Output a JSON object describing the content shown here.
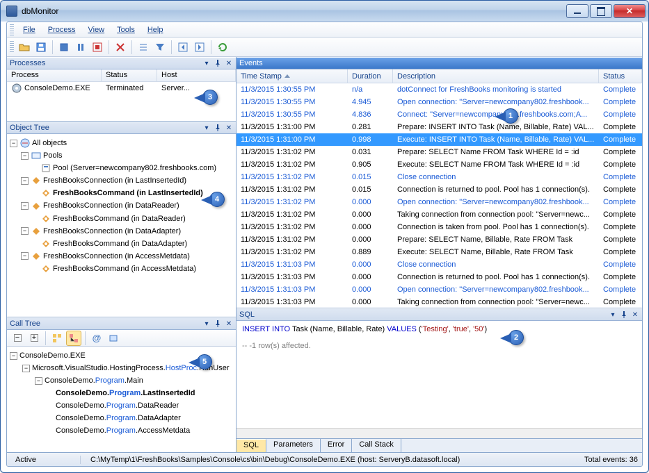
{
  "window": {
    "title": "dbMonitor"
  },
  "menu": [
    "File",
    "Process",
    "View",
    "Tools",
    "Help"
  ],
  "panels": {
    "processes": "Processes",
    "object_tree": "Object Tree",
    "call_tree": "Call Tree",
    "events": "Events",
    "sql": "SQL"
  },
  "proc_cols": {
    "p": "Process",
    "s": "Status",
    "h": "Host"
  },
  "processes": [
    {
      "name": "ConsoleDemo.EXE",
      "status": "Terminated",
      "host": "Server..."
    }
  ],
  "obj_tree": {
    "root": "All objects",
    "pools": "Pools",
    "pool_item": "Pool (Server=newcompany802.freshbooks.com)",
    "c1": "FreshBooksConnection (in LastInsertedId)",
    "c1cmd": "FreshBooksCommand (in LastInsertedId)",
    "c2": "FreshBooksConnection (in DataReader)",
    "c2cmd": "FreshBooksCommand (in DataReader)",
    "c3": "FreshBooksConnection (in DataAdapter)",
    "c3cmd": "FreshBooksCommand (in DataAdapter)",
    "c4": "FreshBooksConnection (in AccessMetdata)",
    "c4cmd": "FreshBooksCommand (in AccessMetdata)"
  },
  "call_tree": {
    "root": "ConsoleDemo.EXE",
    "n1a": "Microsoft.VisualStudio.HostingProcess.",
    "n1b": "HostProc",
    "n1c": ".RunUser",
    "n2a": "ConsoleDemo.",
    "n2b": "Program",
    "n2c": ".Main",
    "n3a": "ConsoleDemo.",
    "n3b": "Program",
    "n3c": ".LastInsertedId",
    "n4a": "ConsoleDemo.",
    "n4b": "Program",
    "n4c": ".DataReader",
    "n5a": "ConsoleDemo.",
    "n5b": "Program",
    "n5c": ".DataAdapter",
    "n6a": "ConsoleDemo.",
    "n6b": "Program",
    "n6c": ".AccessMetdata"
  },
  "ev_cols": {
    "ts": "Time Stamp",
    "du": "Duration",
    "de": "Description",
    "st": "Status"
  },
  "events": [
    {
      "ts": "11/3/2015 1:30:55 PM",
      "du": "n/a",
      "de": "dotConnect for FreshBooks monitoring is started",
      "st": "Complete",
      "link": true
    },
    {
      "ts": "11/3/2015 1:30:55 PM",
      "du": "4.945",
      "de": "Open connection: \"Server=newcompany802.freshbook...",
      "st": "Complete",
      "link": true
    },
    {
      "ts": "11/3/2015 1:30:55 PM",
      "du": "4.836",
      "de": "Connect: \"Server=newcompany802.freshbooks.com;A...",
      "st": "Complete",
      "link": true
    },
    {
      "ts": "11/3/2015 1:31:00 PM",
      "du": "0.281",
      "de": "Prepare: INSERT INTO Task (Name, Billable, Rate) VAL...",
      "st": "Complete"
    },
    {
      "ts": "11/3/2015 1:31:00 PM",
      "du": "0.998",
      "de": "Execute: INSERT INTO Task (Name, Billable, Rate) VAL...",
      "st": "Complete",
      "sel": true
    },
    {
      "ts": "11/3/2015 1:31:02 PM",
      "du": "0.031",
      "de": "Prepare: SELECT Name FROM Task WHERE Id = :id",
      "st": "Complete"
    },
    {
      "ts": "11/3/2015 1:31:02 PM",
      "du": "0.905",
      "de": "Execute: SELECT Name FROM Task WHERE Id = :id",
      "st": "Complete"
    },
    {
      "ts": "11/3/2015 1:31:02 PM",
      "du": "0.015",
      "de": "Close connection",
      "st": "Complete",
      "link": true
    },
    {
      "ts": "11/3/2015 1:31:02 PM",
      "du": "0.015",
      "de": "Connection is returned to pool. Pool has 1 connection(s).",
      "st": "Complete"
    },
    {
      "ts": "11/3/2015 1:31:02 PM",
      "du": "0.000",
      "de": "Open connection: \"Server=newcompany802.freshbook...",
      "st": "Complete",
      "link": true
    },
    {
      "ts": "11/3/2015 1:31:02 PM",
      "du": "0.000",
      "de": "Taking connection from connection pool: \"Server=newc...",
      "st": "Complete"
    },
    {
      "ts": "11/3/2015 1:31:02 PM",
      "du": "0.000",
      "de": "Connection is taken from pool. Pool has 1 connection(s).",
      "st": "Complete"
    },
    {
      "ts": "11/3/2015 1:31:02 PM",
      "du": "0.000",
      "de": "Prepare: SELECT Name, Billable, Rate FROM Task",
      "st": "Complete"
    },
    {
      "ts": "11/3/2015 1:31:02 PM",
      "du": "0.889",
      "de": "Execute: SELECT Name, Billable, Rate FROM Task",
      "st": "Complete"
    },
    {
      "ts": "11/3/2015 1:31:03 PM",
      "du": "0.000",
      "de": "Close connection",
      "st": "Complete",
      "link": true
    },
    {
      "ts": "11/3/2015 1:31:03 PM",
      "du": "0.000",
      "de": "Connection is returned to pool. Pool has 1 connection(s).",
      "st": "Complete"
    },
    {
      "ts": "11/3/2015 1:31:03 PM",
      "du": "0.000",
      "de": "Open connection: \"Server=newcompany802.freshbook...",
      "st": "Complete",
      "link": true
    },
    {
      "ts": "11/3/2015 1:31:03 PM",
      "du": "0.000",
      "de": "Taking connection from connection pool: \"Server=newc...",
      "st": "Complete"
    }
  ],
  "sql": {
    "kw1": "INSERT",
    "kw2": "INTO",
    "t1": " Task (Name, Billable, Rate) ",
    "kw3": "VALUES",
    "t2": " (",
    "s1": "'Testing'",
    "t3": ", ",
    "s2": "'true'",
    "t4": ", ",
    "s3": "'50'",
    "t5": ")",
    "comment": "-- -1 row(s) affected."
  },
  "sql_tabs": [
    "SQL",
    "Parameters",
    "Error",
    "Call Stack"
  ],
  "status": {
    "state": "Active",
    "path": "C:\\MyTemp\\1\\FreshBooks\\Samples\\Console\\cs\\bin\\Debug\\ConsoleDemo.EXE (host: ServeryB.datasoft.local)",
    "total": "Total events: 36"
  },
  "bubbles": {
    "1": "1",
    "2": "2",
    "3": "3",
    "4": "4",
    "5": "5"
  }
}
